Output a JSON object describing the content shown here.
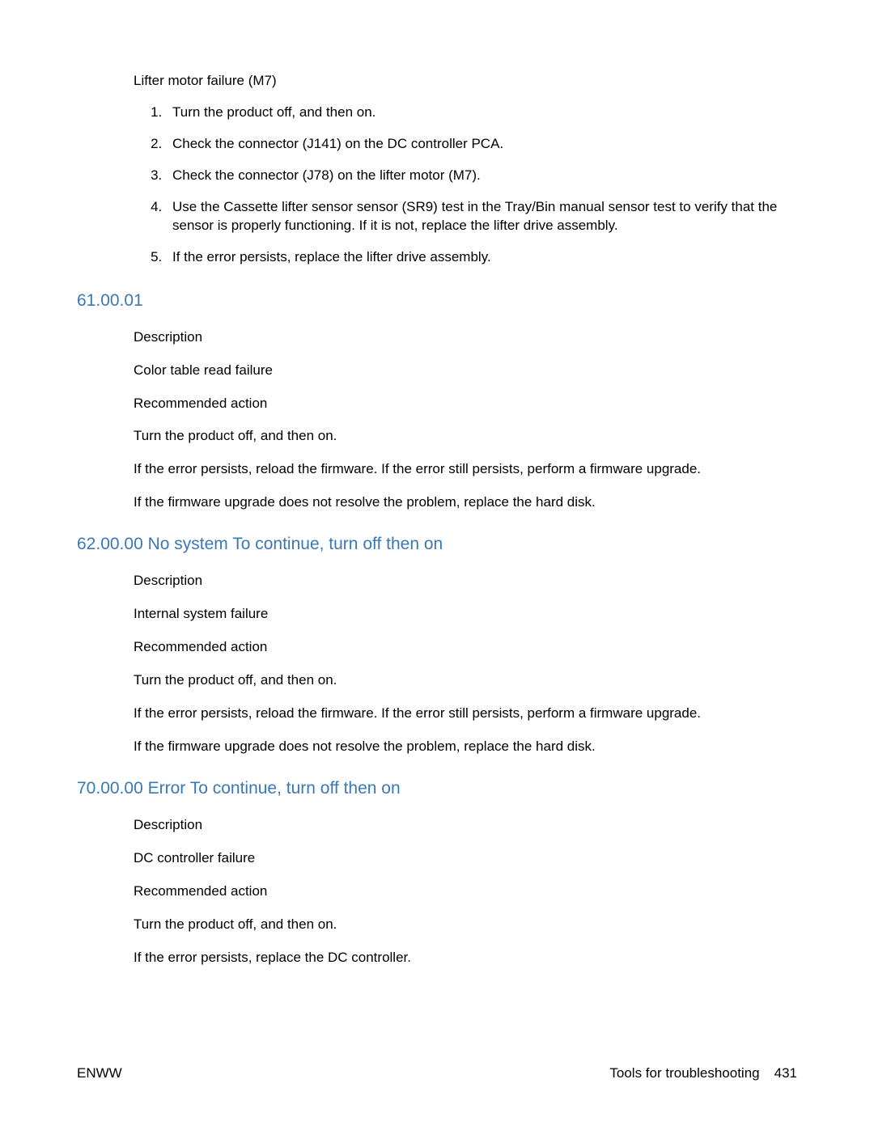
{
  "intro": "Lifter motor failure (M7)",
  "steps": [
    "Turn the product off, and then on.",
    "Check the connector (J141) on the DC controller PCA.",
    "Check the connector (J78) on the lifter motor (M7).",
    "Use the Cassette lifter sensor sensor (SR9) test in the Tray/Bin manual sensor test to verify that the sensor is properly functioning. If it is not, replace the lifter drive assembly.",
    "If the error persists, replace the lifter drive assembly."
  ],
  "sections": [
    {
      "heading": "61.00.01",
      "paragraphs": [
        "Description",
        "Color table read failure",
        "Recommended action",
        "Turn the product off, and then on.",
        "If the error persists, reload the firmware. If the error still persists, perform a firmware upgrade.",
        "If the firmware upgrade does not resolve the problem, replace the hard disk."
      ]
    },
    {
      "heading": "62.00.00 No system To continue, turn off then on",
      "paragraphs": [
        "Description",
        "Internal system failure",
        "Recommended action",
        "Turn the product off, and then on.",
        "If the error persists, reload the firmware. If the error still persists, perform a firmware upgrade.",
        "If the firmware upgrade does not resolve the problem, replace the hard disk."
      ]
    },
    {
      "heading": "70.00.00 Error To continue, turn off then on",
      "paragraphs": [
        "Description",
        "DC controller failure",
        "Recommended action",
        "Turn the product off, and then on.",
        "If the error persists, replace the DC controller."
      ]
    }
  ],
  "footer": {
    "left": "ENWW",
    "right_label": "Tools for troubleshooting",
    "page_number": "431"
  }
}
